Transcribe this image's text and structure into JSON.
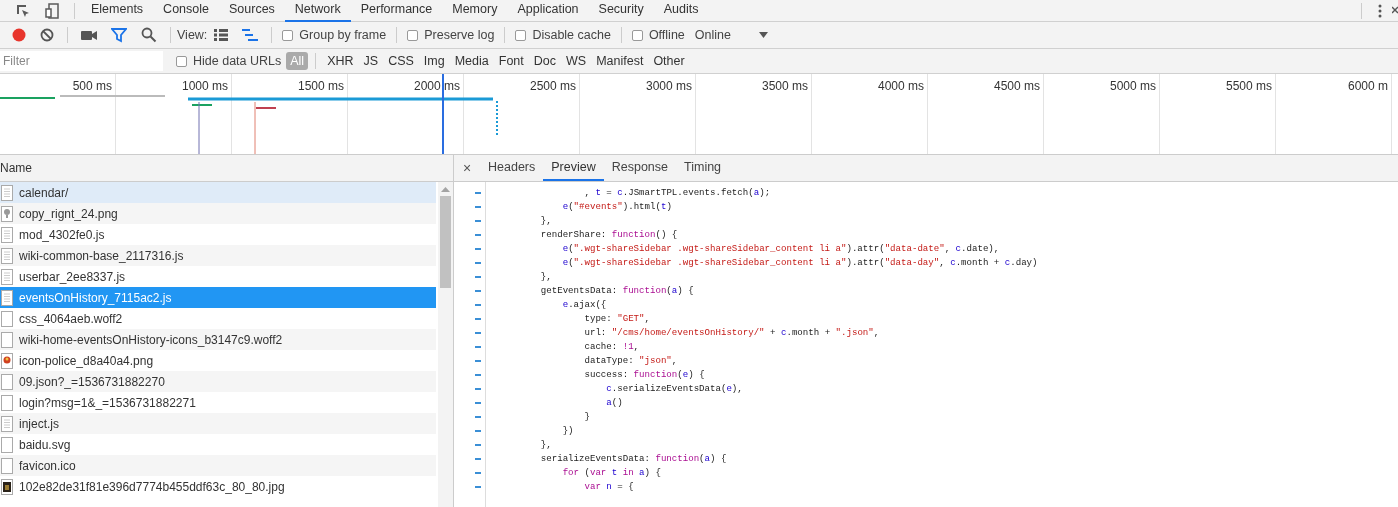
{
  "panel_tabs": [
    {
      "label": "Elements",
      "selected": false
    },
    {
      "label": "Console",
      "selected": false
    },
    {
      "label": "Sources",
      "selected": false
    },
    {
      "label": "Network",
      "selected": true
    },
    {
      "label": "Performance",
      "selected": false
    },
    {
      "label": "Memory",
      "selected": false
    },
    {
      "label": "Application",
      "selected": false
    },
    {
      "label": "Security",
      "selected": false
    },
    {
      "label": "Audits",
      "selected": false
    }
  ],
  "toolbar": {
    "recording": true,
    "filter_active": true,
    "view_label": "View:",
    "large_rows": false,
    "overview": true,
    "checkboxes": [
      {
        "label": "Group by frame",
        "checked": false
      },
      {
        "label": "Preserve log",
        "checked": false
      },
      {
        "label": "Disable cache",
        "checked": false
      },
      {
        "label": "Offline",
        "checked": false
      }
    ],
    "throttling": "Online"
  },
  "filter_bar": {
    "placeholder": "Filter",
    "hide_data_urls": {
      "label": "Hide data URLs",
      "checked": false
    },
    "types": [
      {
        "label": "All",
        "selected": true
      },
      {
        "label": "XHR",
        "selected": false
      },
      {
        "label": "JS",
        "selected": false
      },
      {
        "label": "CSS",
        "selected": false
      },
      {
        "label": "Img",
        "selected": false
      },
      {
        "label": "Media",
        "selected": false
      },
      {
        "label": "Font",
        "selected": false
      },
      {
        "label": "Doc",
        "selected": false
      },
      {
        "label": "WS",
        "selected": false
      },
      {
        "label": "Manifest",
        "selected": false
      },
      {
        "label": "Other",
        "selected": false
      }
    ]
  },
  "timeline": {
    "ticks": [
      "500 ms",
      "1000 ms",
      "1500 ms",
      "2000 ms",
      "2500 ms",
      "3000 ms",
      "3500 ms",
      "4000 ms",
      "4500 ms",
      "5000 ms",
      "5500 ms",
      "6000 m"
    ]
  },
  "requests": {
    "column": "Name",
    "rows": [
      {
        "name": "calendar/",
        "kind": "document",
        "selected": false,
        "hovered": true
      },
      {
        "name": "copy_rignt_24.png",
        "kind": "image",
        "selected": false,
        "hovered": false
      },
      {
        "name": "mod_4302fe0.js",
        "kind": "document",
        "selected": false,
        "hovered": false
      },
      {
        "name": "wiki-common-base_2117316.js",
        "kind": "document",
        "selected": false,
        "hovered": false
      },
      {
        "name": "userbar_2ee8337.js",
        "kind": "document",
        "selected": false,
        "hovered": false
      },
      {
        "name": "eventsOnHistory_7115ac2.js",
        "kind": "document",
        "selected": true,
        "hovered": false
      },
      {
        "name": "css_4064aeb.woff2",
        "kind": "blank",
        "selected": false,
        "hovered": false
      },
      {
        "name": "wiki-home-eventsOnHistory-icons_b3147c9.woff2",
        "kind": "blank",
        "selected": false,
        "hovered": false
      },
      {
        "name": "icon-police_d8a40a4.png",
        "kind": "badge",
        "selected": false,
        "hovered": false
      },
      {
        "name": "09.json?_=1536731882270",
        "kind": "blank",
        "selected": false,
        "hovered": false
      },
      {
        "name": "login?msg=1&_=1536731882271",
        "kind": "blank",
        "selected": false,
        "hovered": false
      },
      {
        "name": "inject.js",
        "kind": "document",
        "selected": false,
        "hovered": false
      },
      {
        "name": "baidu.svg",
        "kind": "blank",
        "selected": false,
        "hovered": false
      },
      {
        "name": "favicon.ico",
        "kind": "blank",
        "selected": false,
        "hovered": false
      },
      {
        "name": "102e82de31f81e396d7774b455ddf63c_80_80.jpg",
        "kind": "photo",
        "selected": false,
        "hovered": false
      }
    ]
  },
  "detail": {
    "close": "×",
    "tabs": [
      {
        "label": "Headers",
        "selected": false
      },
      {
        "label": "Preview",
        "selected": true
      },
      {
        "label": "Response",
        "selected": false
      },
      {
        "label": "Timing",
        "selected": false
      }
    ],
    "code": [
      {
        "tokens": [
          {
            "kind": "plain",
            "text": "            , "
          },
          {
            "kind": "var",
            "text": "t"
          },
          {
            "kind": "plain",
            "text": " = "
          },
          {
            "kind": "var",
            "text": "c"
          },
          {
            "kind": "plain",
            "text": ".JSmartTPL.events.fetch("
          },
          {
            "kind": "var",
            "text": "a"
          },
          {
            "kind": "plain",
            "text": ");"
          }
        ]
      },
      {
        "tokens": [
          {
            "kind": "var",
            "text": "        e"
          },
          {
            "kind": "plain",
            "text": "("
          },
          {
            "kind": "string",
            "text": "\"#events\""
          },
          {
            "kind": "plain",
            "text": ").html("
          },
          {
            "kind": "var",
            "text": "t"
          },
          {
            "kind": "plain",
            "text": ")"
          }
        ]
      },
      {
        "tokens": [
          {
            "kind": "plain",
            "text": "    },"
          }
        ]
      },
      {
        "tokens": [
          {
            "kind": "plain",
            "text": "    renderShare: "
          },
          {
            "kind": "keyword",
            "text": "function"
          },
          {
            "kind": "plain",
            "text": "() {"
          }
        ]
      },
      {
        "tokens": [
          {
            "kind": "var",
            "text": "        e"
          },
          {
            "kind": "plain",
            "text": "("
          },
          {
            "kind": "string",
            "text": "\".wgt-shareSidebar .wgt-shareSidebar_content li a\""
          },
          {
            "kind": "plain",
            "text": ").attr("
          },
          {
            "kind": "string",
            "text": "\"data-date\""
          },
          {
            "kind": "plain",
            "text": ", "
          },
          {
            "kind": "var",
            "text": "c"
          },
          {
            "kind": "plain",
            "text": ".date),"
          }
        ]
      },
      {
        "tokens": [
          {
            "kind": "var",
            "text": "        e"
          },
          {
            "kind": "plain",
            "text": "("
          },
          {
            "kind": "string",
            "text": "\".wgt-shareSidebar .wgt-shareSidebar_content li a\""
          },
          {
            "kind": "plain",
            "text": ").attr("
          },
          {
            "kind": "string",
            "text": "\"data-day\""
          },
          {
            "kind": "plain",
            "text": ", "
          },
          {
            "kind": "var",
            "text": "c"
          },
          {
            "kind": "plain",
            "text": ".month + "
          },
          {
            "kind": "var",
            "text": "c"
          },
          {
            "kind": "plain",
            "text": ".day)"
          }
        ]
      },
      {
        "tokens": [
          {
            "kind": "plain",
            "text": "    },"
          }
        ]
      },
      {
        "tokens": [
          {
            "kind": "plain",
            "text": "    getEventsData: "
          },
          {
            "kind": "keyword",
            "text": "function"
          },
          {
            "kind": "plain",
            "text": "("
          },
          {
            "kind": "var",
            "text": "a"
          },
          {
            "kind": "plain",
            "text": ") {"
          }
        ]
      },
      {
        "tokens": [
          {
            "kind": "var",
            "text": "        e"
          },
          {
            "kind": "plain",
            "text": ".ajax({"
          }
        ]
      },
      {
        "tokens": [
          {
            "kind": "plain",
            "text": "            type: "
          },
          {
            "kind": "string",
            "text": "\"GET\""
          },
          {
            "kind": "plain",
            "text": ","
          }
        ]
      },
      {
        "tokens": [
          {
            "kind": "plain",
            "text": "            url: "
          },
          {
            "kind": "string",
            "text": "\"/cms/home/eventsOnHistory/\""
          },
          {
            "kind": "plain",
            "text": " + "
          },
          {
            "kind": "var",
            "text": "c"
          },
          {
            "kind": "plain",
            "text": ".month + "
          },
          {
            "kind": "string",
            "text": "\".json\""
          },
          {
            "kind": "plain",
            "text": ","
          }
        ]
      },
      {
        "tokens": [
          {
            "kind": "plain",
            "text": "            cache: "
          },
          {
            "kind": "keyword",
            "text": "!1"
          },
          {
            "kind": "plain",
            "text": ","
          }
        ]
      },
      {
        "tokens": [
          {
            "kind": "plain",
            "text": "            dataType: "
          },
          {
            "kind": "string",
            "text": "\"json\""
          },
          {
            "kind": "plain",
            "text": ","
          }
        ]
      },
      {
        "tokens": [
          {
            "kind": "plain",
            "text": "            success: "
          },
          {
            "kind": "keyword",
            "text": "function"
          },
          {
            "kind": "plain",
            "text": "("
          },
          {
            "kind": "var",
            "text": "e"
          },
          {
            "kind": "plain",
            "text": ") {"
          }
        ]
      },
      {
        "tokens": [
          {
            "kind": "var",
            "text": "                c"
          },
          {
            "kind": "plain",
            "text": ".serializeEventsData("
          },
          {
            "kind": "var",
            "text": "e"
          },
          {
            "kind": "plain",
            "text": "),"
          }
        ]
      },
      {
        "tokens": [
          {
            "kind": "var",
            "text": "                a"
          },
          {
            "kind": "plain",
            "text": "()"
          }
        ]
      },
      {
        "tokens": [
          {
            "kind": "plain",
            "text": "            }"
          }
        ]
      },
      {
        "tokens": [
          {
            "kind": "plain",
            "text": "        })"
          }
        ]
      },
      {
        "tokens": [
          {
            "kind": "plain",
            "text": "    },"
          }
        ]
      },
      {
        "tokens": [
          {
            "kind": "plain",
            "text": "    serializeEventsData: "
          },
          {
            "kind": "keyword",
            "text": "function"
          },
          {
            "kind": "plain",
            "text": "("
          },
          {
            "kind": "var",
            "text": "a"
          },
          {
            "kind": "plain",
            "text": ") {"
          }
        ]
      },
      {
        "tokens": [
          {
            "kind": "keyword",
            "text": "        for"
          },
          {
            "kind": "plain",
            "text": " ("
          },
          {
            "kind": "keyword",
            "text": "var"
          },
          {
            "kind": "var",
            "text": " t"
          },
          {
            "kind": "keyword",
            "text": " in"
          },
          {
            "kind": "var",
            "text": " a"
          },
          {
            "kind": "plain",
            "text": ") {"
          }
        ]
      },
      {
        "tokens": [
          {
            "kind": "keyword",
            "text": "            var"
          },
          {
            "kind": "var",
            "text": " n"
          },
          {
            "kind": "plain",
            "text": " = {"
          }
        ]
      }
    ]
  }
}
